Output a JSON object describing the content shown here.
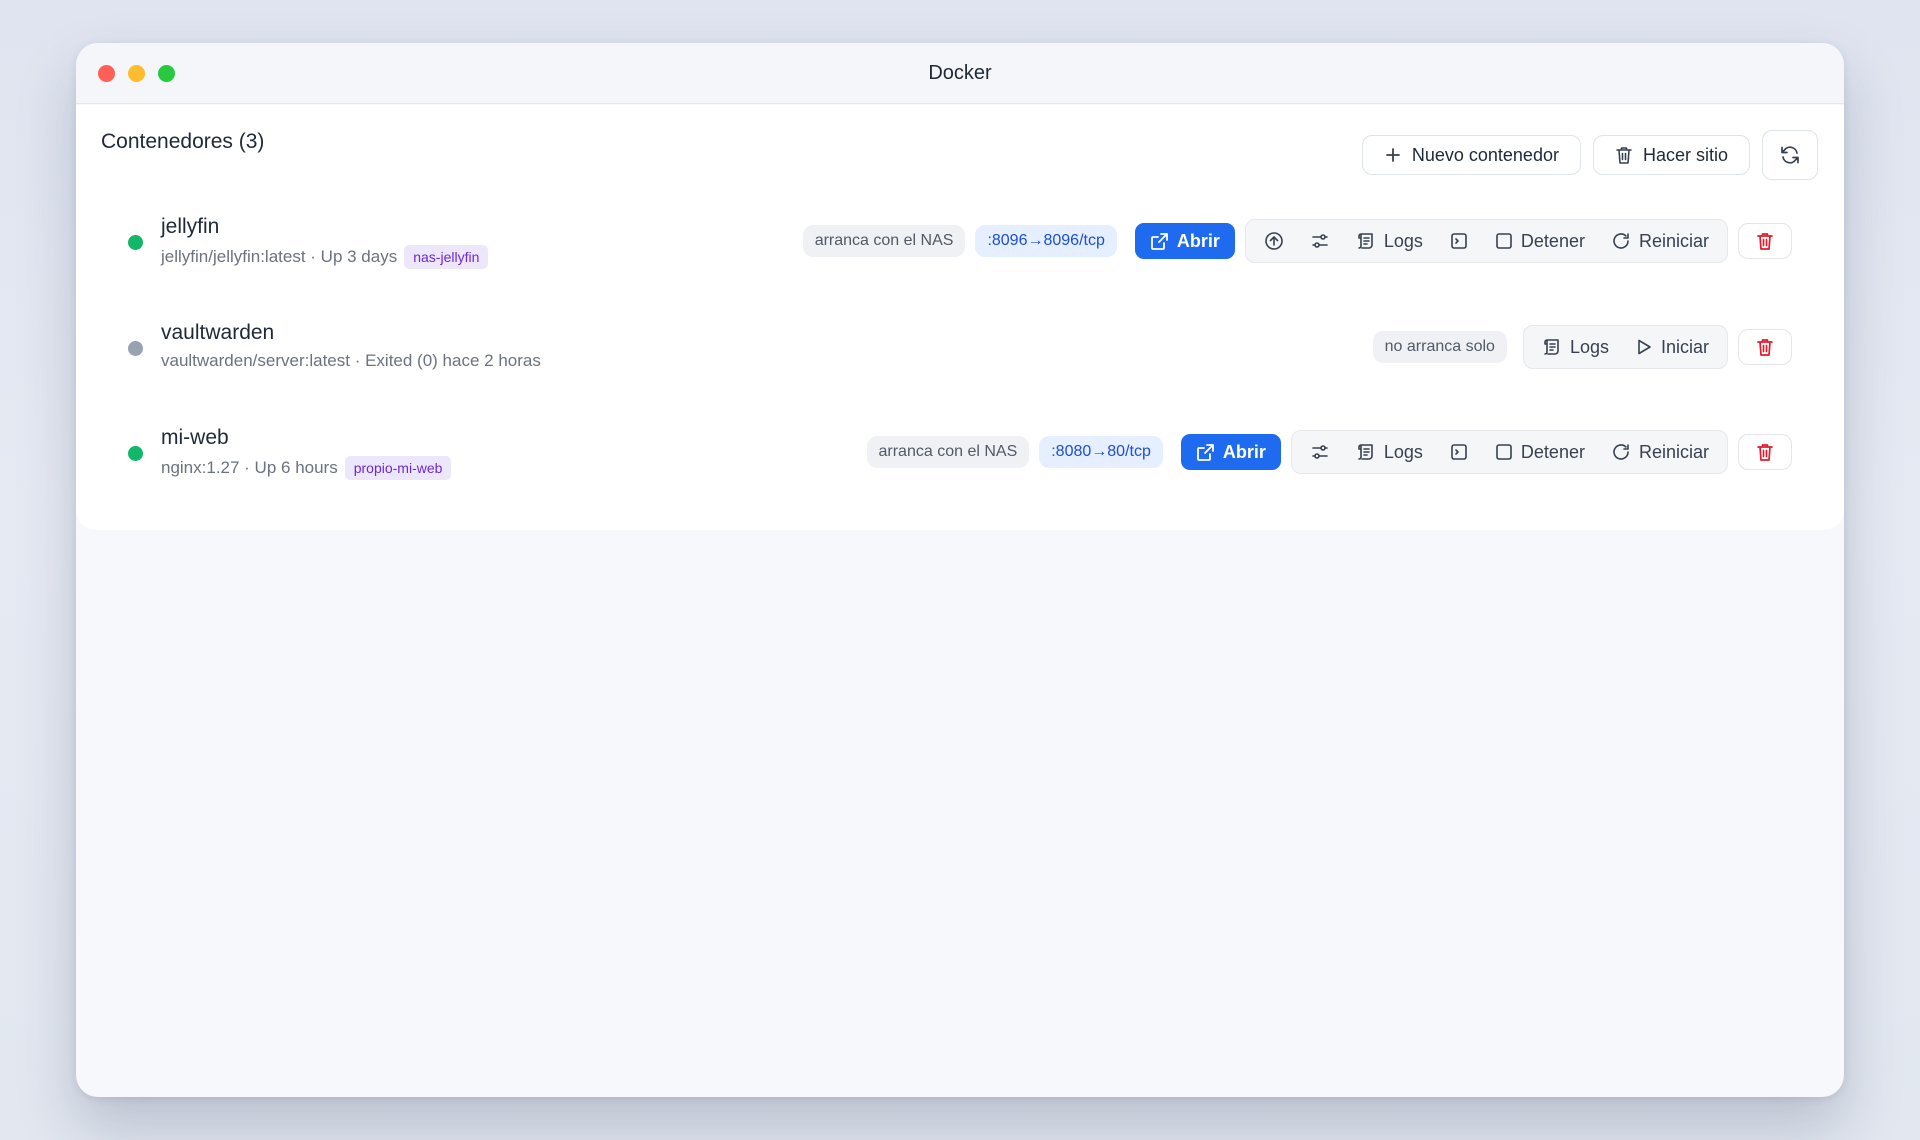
{
  "window": {
    "title": "Docker",
    "traffic_lights": [
      "#fe5f57",
      "#febc2e",
      "#28c840"
    ]
  },
  "header": {
    "title": "Contenedores (3)",
    "new_container_label": "Nuevo contenedor",
    "cleanup_label": "Hacer sitio"
  },
  "colors": {
    "running": "#12b76a",
    "stopped": "#98a2b3",
    "accent": "#1f6bf0",
    "danger": "#e11d2e"
  },
  "containers": [
    {
      "name": "jellyfin",
      "meta": "jellyfin/jellyfin:latest · Up 3 days",
      "tag": "nas-jellyfin",
      "status": "running",
      "autostart": "arranca con el NAS",
      "port": ":8096→8096/tcp",
      "open_label": "Abrir",
      "logs_label": "Logs",
      "stop_label": "Detener",
      "restart_label": "Reiniciar"
    },
    {
      "name": "vaultwarden",
      "meta": "vaultwarden/server:latest · Exited (0) hace 2 horas",
      "status": "stopped",
      "autostart": "no arranca solo",
      "logs_label": "Logs",
      "start_label": "Iniciar"
    },
    {
      "name": "mi-web",
      "meta": "nginx:1.27 · Up 6 hours",
      "tag": "propio-mi-web",
      "status": "running",
      "autostart": "arranca con el NAS",
      "port": ":8080→80/tcp",
      "open_label": "Abrir",
      "logs_label": "Logs",
      "stop_label": "Detener",
      "restart_label": "Reiniciar"
    }
  ]
}
